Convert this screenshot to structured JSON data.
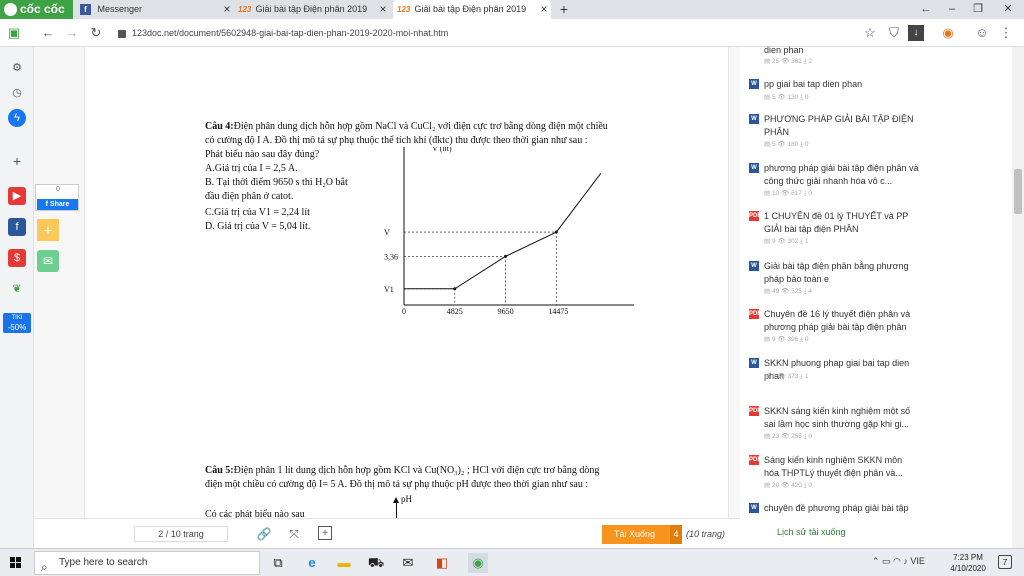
{
  "browser": {
    "brand": "cốc cốc",
    "tabs": [
      {
        "label": "Messenger"
      },
      {
        "label": "Giải bài tập Điện phân 2019"
      },
      {
        "label": "Giải bài tập Điện phân 2019"
      }
    ],
    "favicon_text": "123",
    "url": "123doc.net/document/5602948-giai-bai-tap-dien-phan-2019-2020-moi-nhat.htm"
  },
  "document": {
    "q4": {
      "line1_label": "Câu 4:",
      "line1": "Điện phân dung dịch hỗn hợp gồm NaCl và CuCl₂  với điện cực trơ bằng dòng điện  một chiều",
      "line2": "có cường độ I A. Đồ thị mô tả sự phụ thuộc thể tích khí (đktc)  thu được theo thời gian như sau :",
      "line3": "Phát biểu nào sau đây đúng?",
      "optA": "A.Giá trị của I = 2,5 A.",
      "optB1": "B. Tại thời điểm 9650 s thì H₂O bắt",
      "optB2": "đầu điện phân ở catot.",
      "optC": "C.Giá trị của V1 = 2,24 lít",
      "optD": "D. Giá trị của V = 5,04 lít."
    },
    "q5": {
      "line1_label": "Câu 5:",
      "line1": "Điện phân  1 lít dung dịch hỗn hợp gồm KCl và Cu(NO₃)₂ ; HCl với điện cực trơ bằng dòng",
      "line2": "điện  một chiều có cường độ I= 5 A. Đồ thị mô tả sự phụ thuộc  pH  được theo thời gian như sau :",
      "line3": "Có các phát biểu nào sau",
      "ph_label": "pH"
    }
  },
  "chart_data": {
    "type": "line",
    "ylabel": "V (lít)",
    "xlabel": "t (s)",
    "x_ticks": [
      "0",
      "4825",
      "9650",
      "14475"
    ],
    "y_ticks": [
      "V1",
      "3,36",
      "V"
    ],
    "series": [
      {
        "x": [
          0,
          4825,
          9650,
          14475,
          18700
        ],
        "y": [
          1.12,
          1.12,
          3.36,
          5.04,
          9.1
        ]
      }
    ],
    "xlim": [
      0,
      19000
    ],
    "ylim": [
      0,
      10.5
    ]
  },
  "share": {
    "count": "0",
    "label": "Share"
  },
  "bottom": {
    "page_info": "2 / 10 trang",
    "download_label": "Tải Xuống",
    "download_count": "4",
    "pages_note": "(10 trang)",
    "history_link": "Lịch sử tải xuống"
  },
  "related": [
    {
      "icon": "word",
      "title": "dien phan",
      "files": "25",
      "views": "362",
      "downloads": "2"
    },
    {
      "icon": "word",
      "title": "pp giai bai tap dien phan",
      "files": "5",
      "views": "130",
      "downloads": "0"
    },
    {
      "icon": "word",
      "title": "PHƯƠNG PHÁP GIẢI BÀI TẬP ĐIỆN PHÂN",
      "files": "5",
      "views": "180",
      "downloads": "0"
    },
    {
      "icon": "word",
      "title": "phương pháp giải bài tập điện phân và công thức giải nhanh hóa vô c...",
      "files": "10",
      "views": "617",
      "downloads": "0"
    },
    {
      "icon": "pdf",
      "title": "1 CHUYÊN đề 01 lý THUYẾT và PP GIẢI bài tập điện PHÂN",
      "files": "9",
      "views": "302",
      "downloads": "1"
    },
    {
      "icon": "word",
      "title": "Giải bài tập điện phân bằng phương pháp bảo toàn e",
      "files": "49",
      "views": "525",
      "downloads": "4"
    },
    {
      "icon": "pdf",
      "title": "Chuyên đề 16 lý thuyết điện phân và phương pháp giải bài tập điện phân",
      "files": "9",
      "views": "396",
      "downloads": "0"
    },
    {
      "icon": "word",
      "title": "SKKN phuong phap giai bai tap dien phan",
      "files": "6",
      "views": "373",
      "downloads": "1"
    },
    {
      "icon": "pdf",
      "title": "SKKN sáng kiến kinh nghiệm một số sai lầm học sinh thường gặp khi gi...",
      "files": "23",
      "views": "255",
      "downloads": "0"
    },
    {
      "icon": "pdf",
      "title": "Sáng kiến kinh nghiệm SKKN môn hóa THPTLý thuyết điện phân và...",
      "files": "20",
      "views": "420",
      "downloads": "0"
    },
    {
      "icon": "word",
      "title": "chuyên đề phương pháp giải bài tập",
      "files": "",
      "views": "",
      "downloads": ""
    }
  ],
  "taskbar": {
    "search_placeholder": "Type here to search",
    "lang": "VIE",
    "time": "7:23 PM",
    "date": "4/10/2020",
    "notifications": "7"
  },
  "rail": {
    "discount": "-50%",
    "discount_small": "TIKI"
  }
}
